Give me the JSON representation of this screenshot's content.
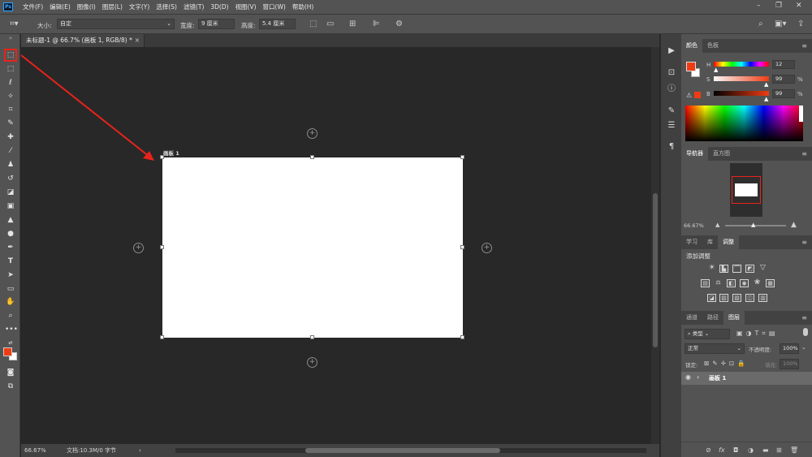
{
  "app": {
    "logo": "Ps"
  },
  "menubar": {
    "items": [
      "文件(F)",
      "编辑(E)",
      "图像(I)",
      "图层(L)",
      "文字(Y)",
      "选择(S)",
      "滤镜(T)",
      "3D(D)",
      "视图(V)",
      "窗口(W)",
      "帮助(H)"
    ]
  },
  "window_controls": {
    "minimize": "–",
    "restore": "❐",
    "close": "✕"
  },
  "options": {
    "size_label": "大小:",
    "size_value": "自定",
    "width_label": "宽度:",
    "width_value": "9 厘米",
    "height_label": "高度:",
    "height_value": "5.4 厘米"
  },
  "document": {
    "tab_title": "未标题-1 @ 66.7% (画板 1, RGB/8) *",
    "close": "×",
    "artboard_label": "画板 1"
  },
  "status": {
    "zoom": "66.67%",
    "doc_info": "文档:10.3M/0 字节",
    "arrow": "›"
  },
  "color_panel": {
    "tabs": [
      "颜色",
      "色板"
    ],
    "h_label": "H",
    "h_value": "12",
    "s_label": "S",
    "s_value": "99",
    "b_label": "B",
    "b_value": "99",
    "unit": "%",
    "foreground_color": "#f03c13",
    "background_color": "#ffffff"
  },
  "navigator_panel": {
    "tabs": [
      "导航器",
      "直方图"
    ],
    "zoom": "66.67%"
  },
  "adjustments_panel": {
    "tabs": [
      "学习",
      "库",
      "调整"
    ],
    "title": "添加调整"
  },
  "layers_panel": {
    "tabs": [
      "通道",
      "路径",
      "图层"
    ],
    "filter_kind": "类型",
    "blend_mode": "正常",
    "opacity_label": "不透明度:",
    "opacity_value": "100%",
    "lock_label": "锁定:",
    "fill_label": "填充:",
    "fill_value": "100%",
    "layer_name": "画板 1",
    "fx": "fx"
  },
  "colors": {
    "annotation_arrow": "#e8231a",
    "ps_accent": "#31a8ff"
  }
}
